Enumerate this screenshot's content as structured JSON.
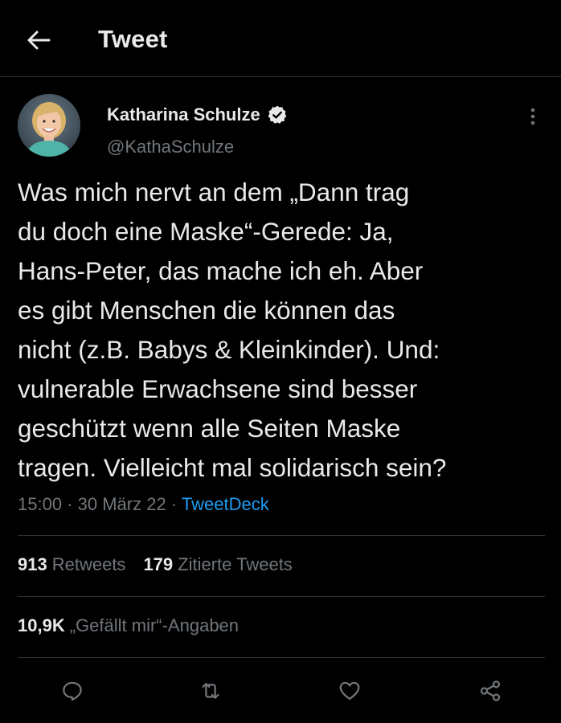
{
  "header": {
    "title": "Tweet",
    "back_icon": "arrow-left-icon"
  },
  "tweet": {
    "author_name": "Katharina Schulze",
    "handle": "@KathaSchulze",
    "verified_icon": "verified-badge-icon",
    "text": "Was mich nervt an dem „Dann trag\ndu doch eine Maske“-Gerede: Ja,\nHans-Peter, das mache ich eh. Aber\nes gibt Menschen die können das\nnicht (z.B. Babys & Kleinkinder). Und:\nvulnerable Erwachsene sind besser\ngeschützt wenn alle Seiten Maske\ntragen. Vielleicht mal solidarisch sein?",
    "time": "15:00",
    "date": "30 März 22",
    "separator": "·",
    "source": "TweetDeck"
  },
  "stats": {
    "retweets_count": "913",
    "retweets_label": "Retweets",
    "quotes_count": "179",
    "quotes_label": "Zitierte Tweets",
    "likes_count": "10,9K",
    "likes_label": "„Gefällt mir“-Angaben"
  },
  "actions": [
    "reply-icon",
    "retweet-icon",
    "like-icon",
    "share-icon"
  ],
  "colors": {
    "background": "#000000",
    "text": "#e7e9ea",
    "secondary": "#71767b",
    "accent": "#1d9bf0",
    "divider": "#2f3336"
  }
}
